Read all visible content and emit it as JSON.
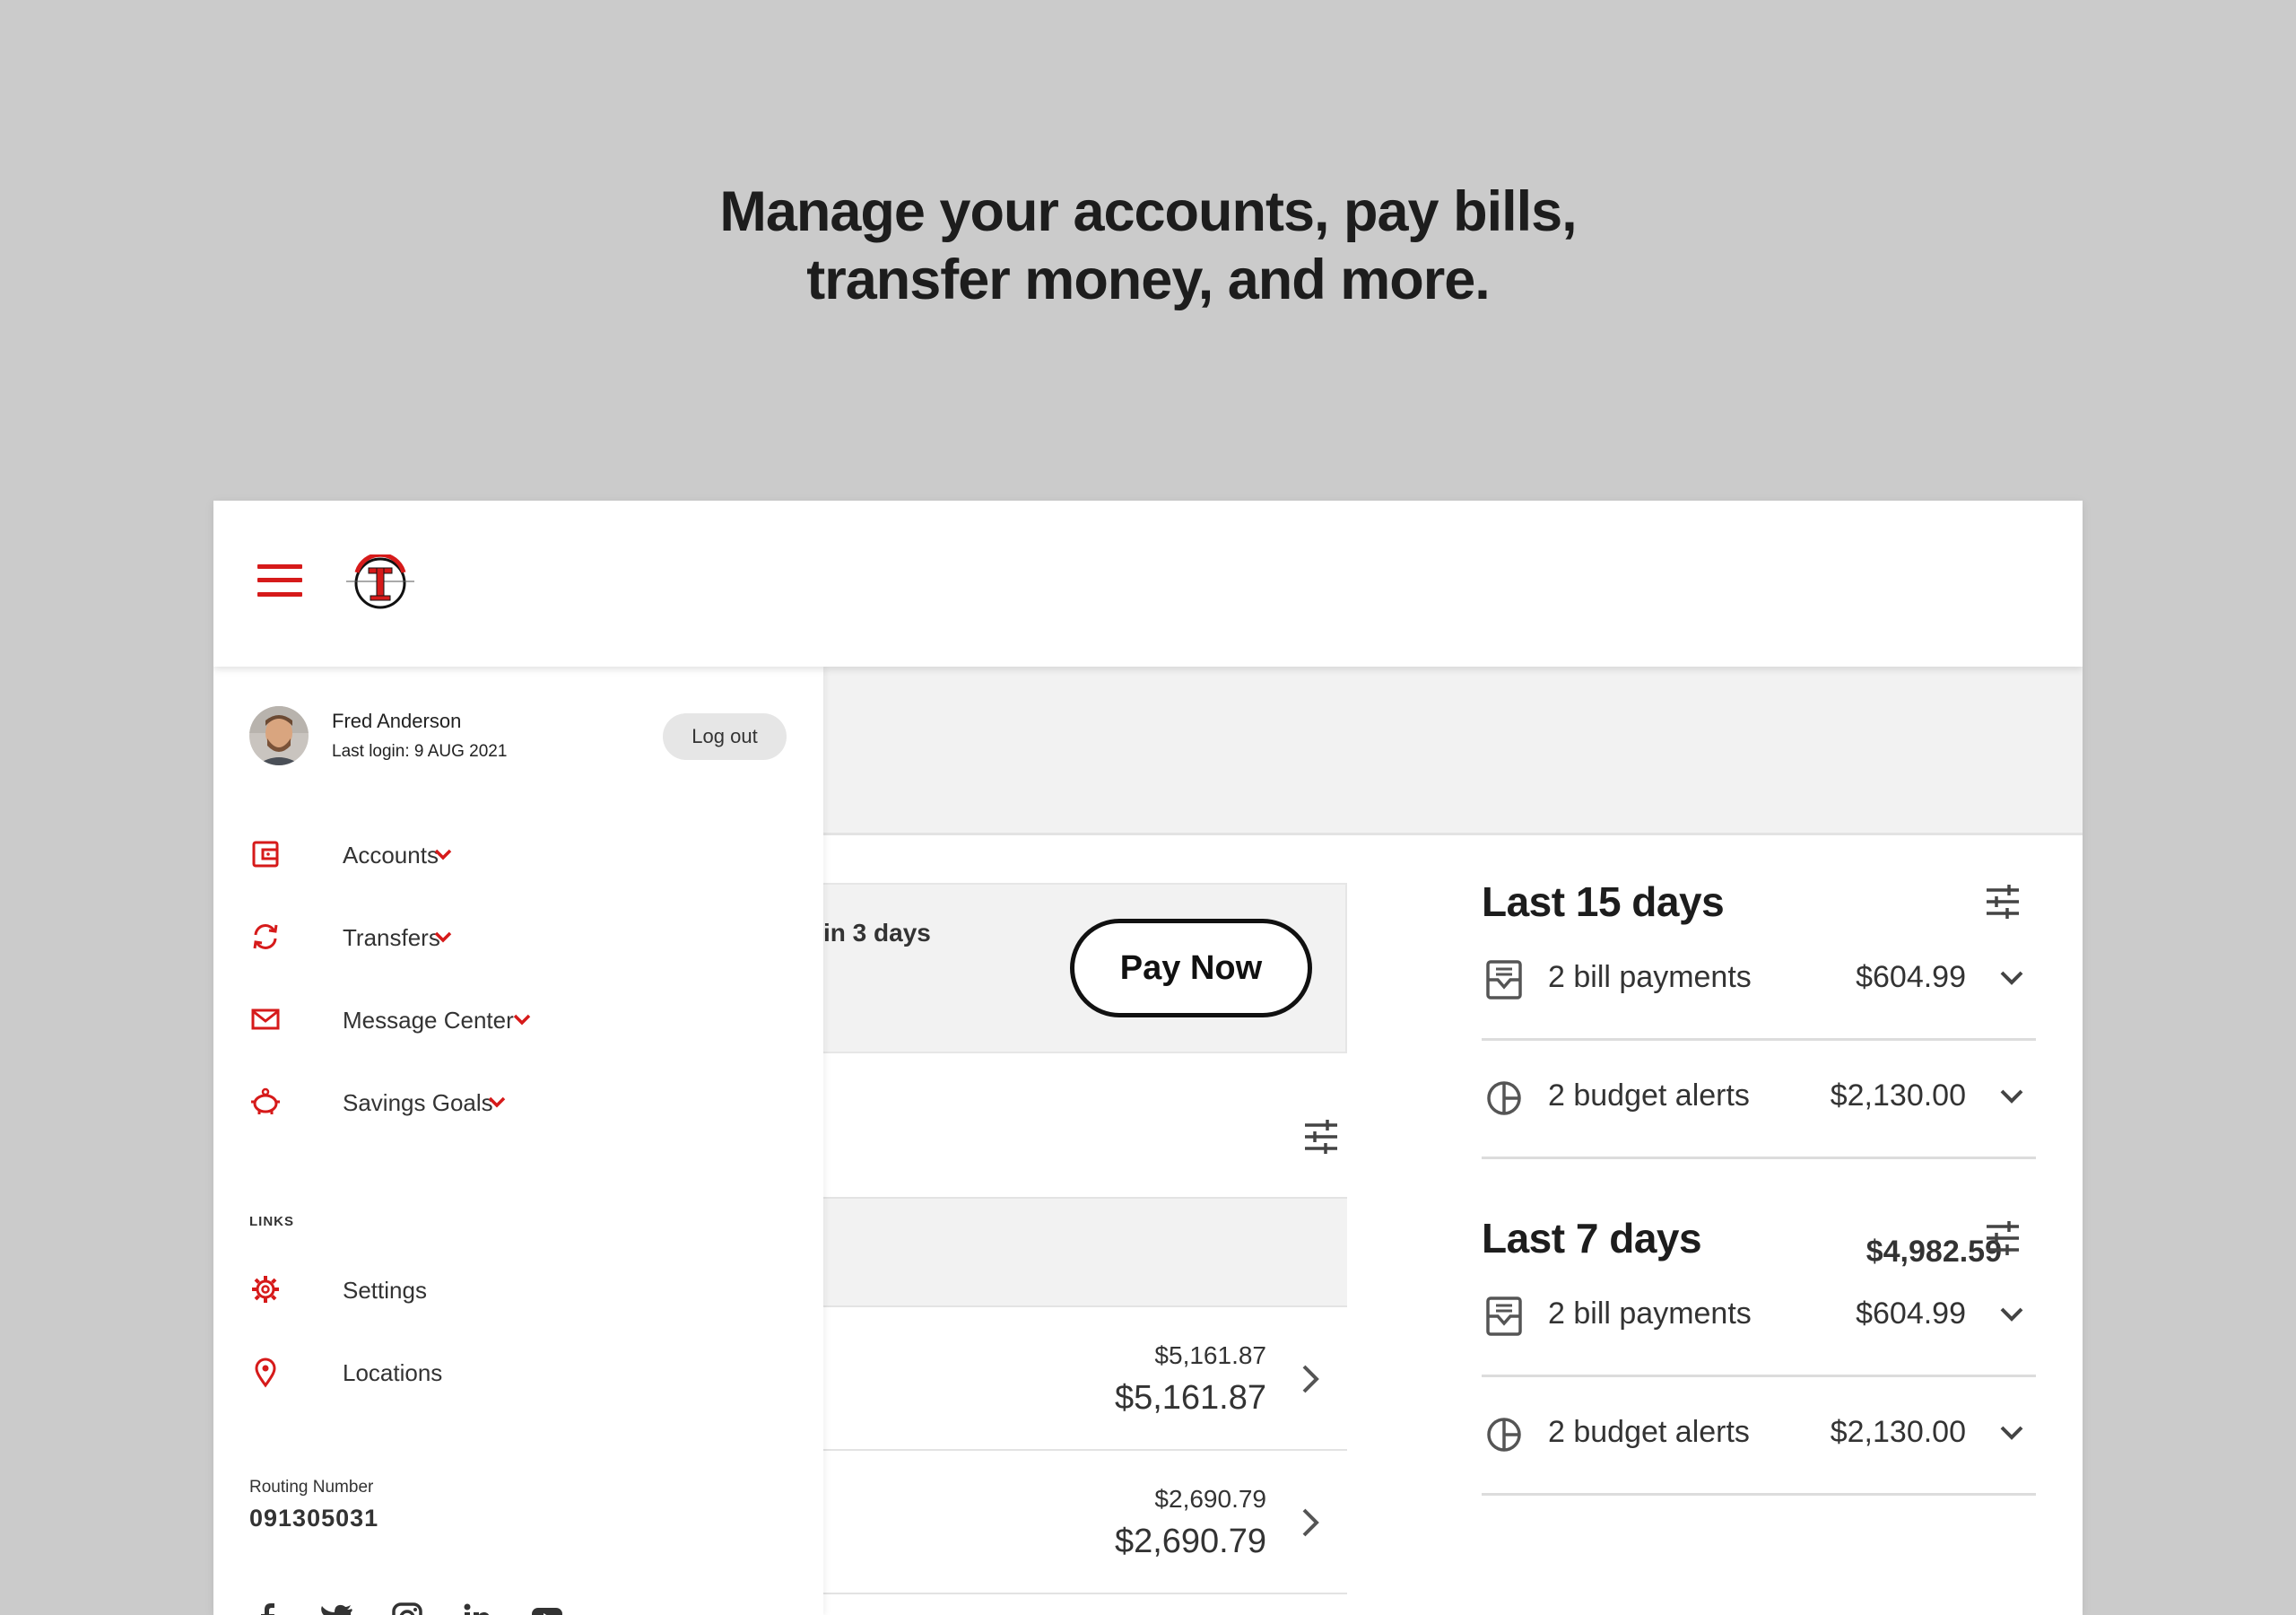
{
  "headline": {
    "line1": "Manage your accounts, pay bills,",
    "line2": "transfer money, and more."
  },
  "colors": {
    "accent": "#d61a1a",
    "page_bg": "#cbcbcb",
    "panel_bg": "#f2f2f2"
  },
  "user": {
    "name": "Fred Anderson",
    "last_login": "Last login: 9 AUG 2021",
    "logout_label": "Log out"
  },
  "nav": [
    {
      "label": "Accounts",
      "icon": "wallet-icon"
    },
    {
      "label": "Transfers",
      "icon": "refresh-icon"
    },
    {
      "label": "Message Center",
      "icon": "envelope-icon"
    },
    {
      "label": "Savings Goals",
      "icon": "piggy-bank-icon"
    }
  ],
  "links": {
    "header": "LINKS",
    "items": [
      {
        "label": "Settings",
        "icon": "gear-icon"
      },
      {
        "label": "Locations",
        "icon": "map-pin-icon"
      }
    ]
  },
  "routing": {
    "label": "Routing Number",
    "number": "091305031"
  },
  "social_icons": [
    "facebook-icon",
    "twitter-icon",
    "instagram-icon",
    "linkedin-icon",
    "youtube-icon"
  ],
  "main": {
    "bill_text": "in 3 days",
    "pay_now_label": "Pay Now",
    "total": "$4,982.59",
    "accounts": [
      {
        "small": "$5,161.87",
        "big": "$5,161.87"
      },
      {
        "small": "$2,690.79",
        "big": "$2,690.79"
      }
    ]
  },
  "summary": [
    {
      "title": "Last 15 days",
      "rows": [
        {
          "label": "2 bill payments",
          "amount": "$604.99",
          "icon": "inbox-icon"
        },
        {
          "label": "2 budget alerts",
          "amount": "$2,130.00",
          "icon": "pie-chart-icon"
        }
      ]
    },
    {
      "title": "Last 7 days",
      "rows": [
        {
          "label": "2 bill payments",
          "amount": "$604.99",
          "icon": "inbox-icon"
        },
        {
          "label": "2 budget alerts",
          "amount": "$2,130.00",
          "icon": "pie-chart-icon"
        }
      ]
    }
  ]
}
